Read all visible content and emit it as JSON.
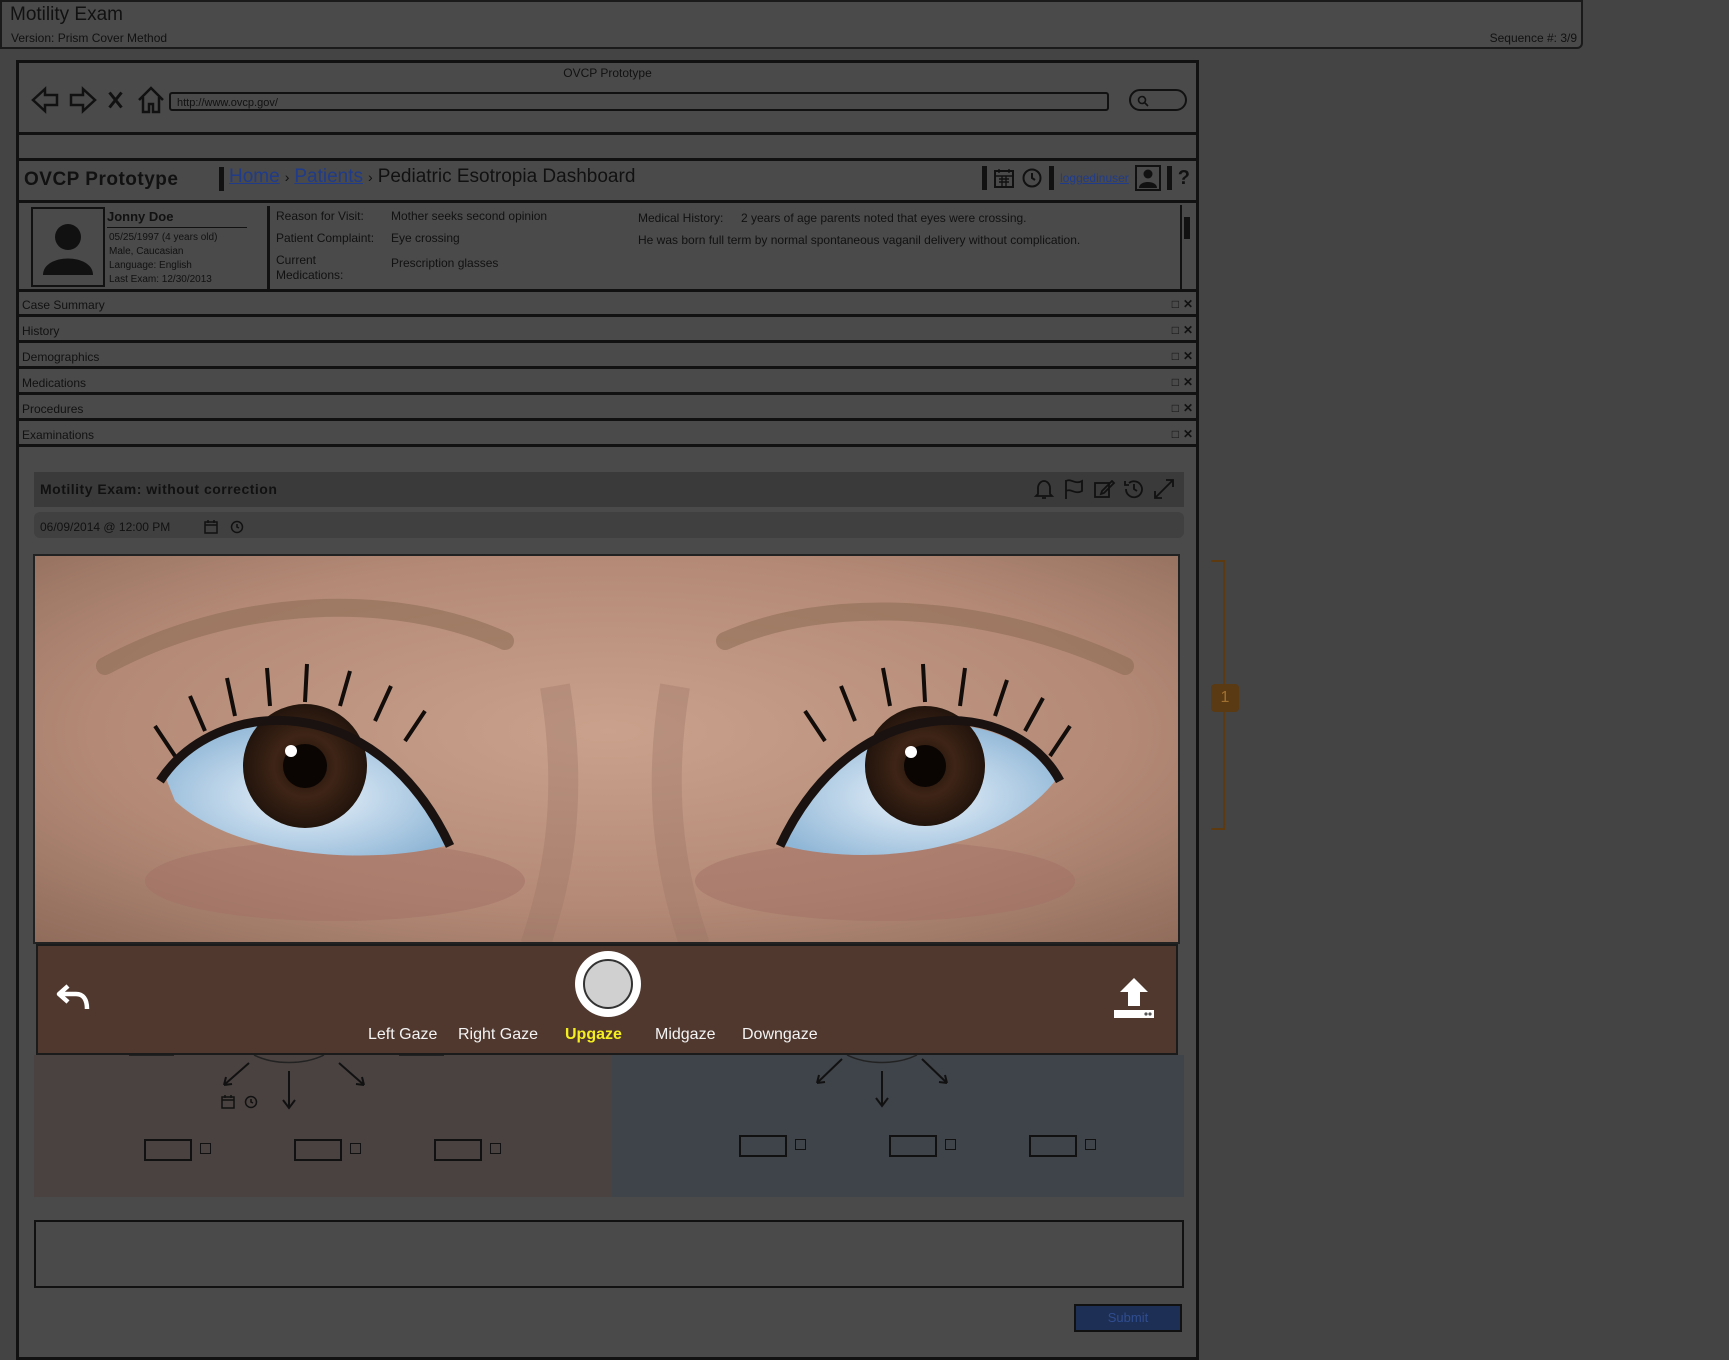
{
  "header": {
    "title": "Motility Exam",
    "version": "Version: Prism Cover Method",
    "sequence": "Sequence #:  3/9"
  },
  "browser": {
    "window_title": "OVCP Prototype",
    "url": "http://www.ovcp.gov/"
  },
  "appnav": {
    "brand": "OVCP Prototype",
    "breadcrumb": [
      "Home",
      "Patients",
      "Pediatric Esotropia Dashboard"
    ],
    "user": "loggedinuser",
    "help": "?"
  },
  "patient": {
    "name": "Jonny Doe",
    "dob": "05/25/1997 (4 years old)",
    "sex_race": "Male, Caucasian",
    "language": "Language: English",
    "last_exam": "Last Exam: 12/30/2013",
    "reason_label": "Reason for Visit:",
    "reason": "Mother seeks second opinion",
    "complaint_label": "Patient Complaint:",
    "complaint": "Eye crossing",
    "meds_label_1": "Current",
    "meds_label_2": "Medications:",
    "meds": "Prescription glasses",
    "history_label": "Medical History:",
    "history_1": "2 years of age parents noted that eyes were crossing.",
    "history_2": "He was born full term by normal spontaneous vaganil delivery without complication."
  },
  "accordion": [
    "Case Summary",
    "History",
    "Demographics",
    "Medications",
    "Procedures",
    "Examinations"
  ],
  "exam": {
    "title": "Motility Exam: without correction",
    "datetime": "06/09/2014 @ 12:00 PM"
  },
  "camera": {
    "gazes": [
      "Left Gaze",
      "Right Gaze",
      "Upgaze",
      "Midgaze",
      "Downgaze"
    ],
    "active_gaze": "Upgaze",
    "active_color": "#f4ef1e"
  },
  "form": {
    "submit_label": "Submit"
  },
  "annotation": {
    "marker": "1"
  }
}
